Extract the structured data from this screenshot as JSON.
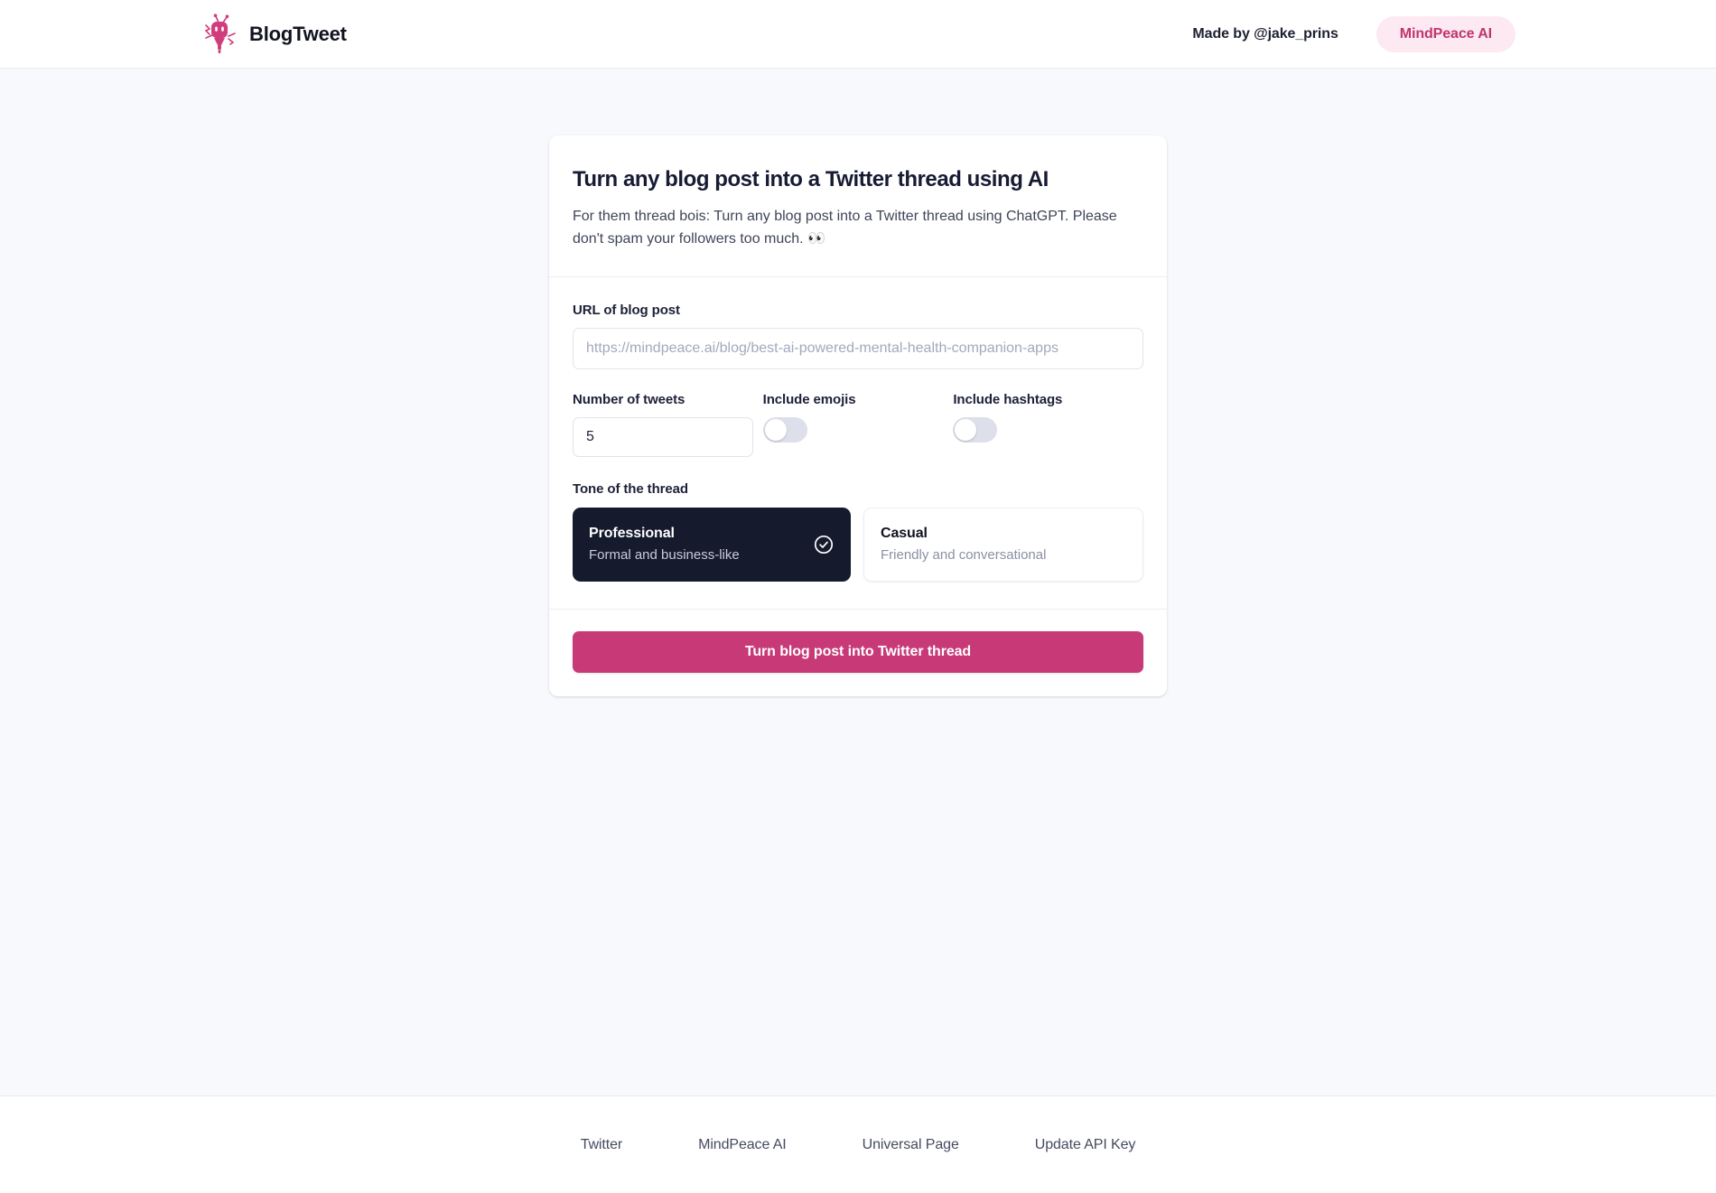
{
  "header": {
    "brand_name": "BlogTweet",
    "logo_icon": "robot-mascot-icon",
    "made_by": "Made by @jake_prins",
    "pill_label": "MindPeace AI"
  },
  "card": {
    "title": "Turn any blog post into a Twitter thread using AI",
    "subtitle": "For them thread bois: Turn any blog post into a Twitter thread using ChatGPT. Please don't spam your followers too much. 👀",
    "url_field": {
      "label": "URL of blog post",
      "placeholder": "https://mindpeace.ai/blog/best-ai-powered-mental-health-companion-apps",
      "value": ""
    },
    "number_field": {
      "label": "Number of tweets",
      "value": "5"
    },
    "toggles": [
      {
        "label": "Include emojis",
        "state": "off"
      },
      {
        "label": "Include hashtags",
        "state": "off"
      }
    ],
    "tone": {
      "label": "Tone of the thread",
      "options": [
        {
          "name": "Professional",
          "description": "Formal and business-like",
          "selected": true,
          "icon": "check-circle-icon"
        },
        {
          "name": "Casual",
          "description": "Friendly and conversational",
          "selected": false,
          "icon": ""
        }
      ]
    },
    "submit_label": "Turn blog post into Twitter thread"
  },
  "footer": {
    "links": [
      {
        "label": "Twitter"
      },
      {
        "label": "MindPeace AI"
      },
      {
        "label": "Universal Page"
      },
      {
        "label": "Update API Key"
      }
    ]
  },
  "colors": {
    "accent_pink": "#c73a77",
    "pill_bg": "#fce9f1",
    "pill_text": "#c0356f",
    "dark_card": "#151a2d",
    "page_bg": "#f8f9fc"
  }
}
